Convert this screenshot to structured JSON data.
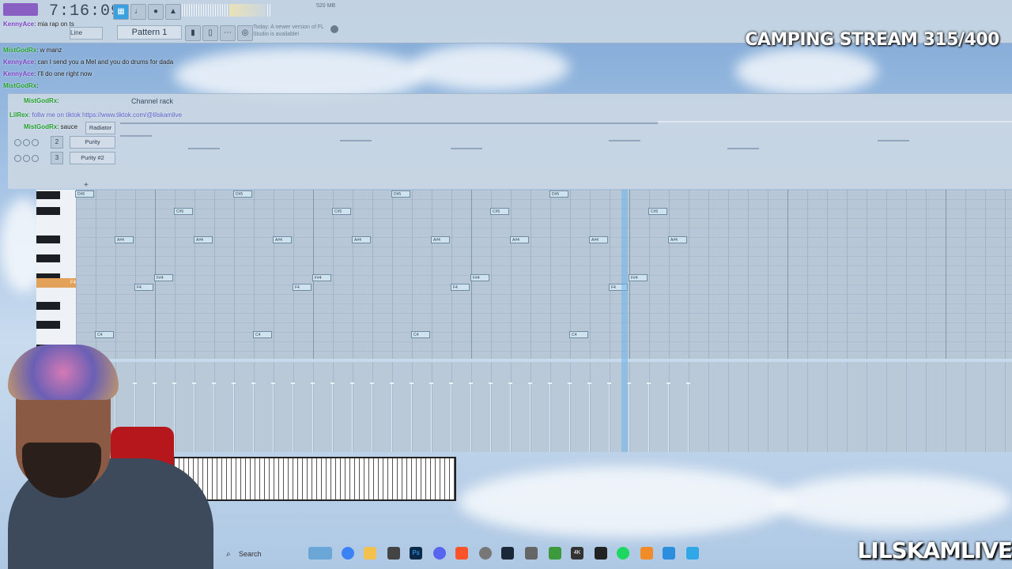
{
  "toolbar": {
    "clock": "7:16:09",
    "pattern": "Pattern 1",
    "mode": "Line",
    "memory": "520 MB",
    "update_hint": "Today: A newer version of FL Studio is available!"
  },
  "stream": {
    "title": "CAMPING STREAM 315/400",
    "brand": "LILSKAMLIVE"
  },
  "chat": [
    {
      "user": "KennyAce",
      "msg": ": mia rap on ts",
      "color": "#7b3fc4"
    },
    {
      "user": "MistGodRx",
      "msg": ": w manz",
      "color": "#1f9e2c"
    },
    {
      "user": "KennyAce",
      "msg": ": can I send you a Mel and you do drums for dada",
      "color": "#7b3fc4"
    },
    {
      "user": "KennyAce",
      "msg": ": I'll do one right now",
      "color": "#7b3fc4"
    },
    {
      "user": "MistGodRx",
      "msg": ":",
      "color": "#1f9e2c"
    },
    {
      "user": "MistGodRx",
      "msg": ":",
      "color": "#1f9e2c"
    },
    {
      "user": "LilRex",
      "msg": ": follw me on tiktok https://www.tiktok.com/@lilskamlive",
      "color": "#1f9e2c"
    },
    {
      "user": "MistGodRx",
      "msg": ": sauce",
      "color": "#1f9e2c"
    }
  ],
  "rack": {
    "title": "Channel rack",
    "channels": [
      {
        "num": "",
        "name": "Radiator"
      },
      {
        "num": "2",
        "name": "Purity"
      },
      {
        "num": "3",
        "name": "Purity #2"
      }
    ]
  },
  "piano": {
    "highlight_key": "F4"
  },
  "taskbar": {
    "search": "Search"
  }
}
